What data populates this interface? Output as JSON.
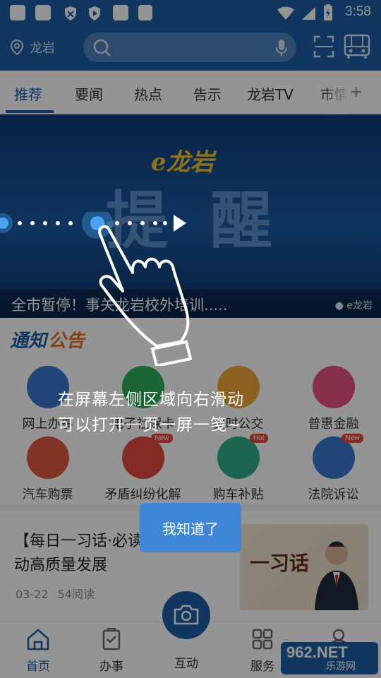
{
  "status_bar": {
    "time": "3:58"
  },
  "header": {
    "location": "龙岩",
    "icons": [
      "location-pin-icon",
      "search-icon",
      "microphone-icon",
      "scan-icon",
      "bus-icon"
    ]
  },
  "tabs": [
    {
      "label": "推荐",
      "active": true
    },
    {
      "label": "要闻"
    },
    {
      "label": "热点"
    },
    {
      "label": "告示"
    },
    {
      "label": "龙岩TV"
    },
    {
      "label": "市情"
    }
  ],
  "banner": {
    "brand": "e龙岩",
    "headline": "提醒",
    "caption": "全市暂停！事关龙岩校外培训.....",
    "source": "e龙岩"
  },
  "notice": {
    "part1": "通知",
    "part2": "公告"
  },
  "services": [
    {
      "label": "网上办事",
      "color": "#3b78cf",
      "badge": ""
    },
    {
      "label": "电子社保卡",
      "color": "#2fae5a",
      "badge": ""
    },
    {
      "label": "实时公交",
      "color": "#f0a53a",
      "badge": ""
    },
    {
      "label": "普惠金融",
      "color": "#e5527c",
      "badge": ""
    },
    {
      "label": "汽车购票",
      "color": "#e05a3f",
      "badge": ""
    },
    {
      "label": "矛盾纠纷化解",
      "color": "#e2493f",
      "badge": "New"
    },
    {
      "label": "购车补贴",
      "color": "#2fae8a",
      "badge": "Hot"
    },
    {
      "label": "法院诉讼",
      "color": "#3b78cf",
      "badge": "New"
    }
  ],
  "news": {
    "title": "【每日一习话·必读】坚定不移推动高质量发展",
    "date": "03-22",
    "reads": "54阅读",
    "thumb_text": "一习话"
  },
  "bottom_nav": [
    {
      "label": "首页",
      "active": true
    },
    {
      "label": "办事"
    },
    {
      "label": "互动"
    },
    {
      "label": "服务"
    },
    {
      "label": "我的"
    }
  ],
  "watermark": {
    "top": "962.NET",
    "bottom": "乐游网"
  },
  "overlay": {
    "hint_line1": "在屏幕左侧区域向右滑动",
    "hint_line2": "可以打开一页一屏一笺~",
    "ok_label": "我知道了"
  },
  "colors": {
    "primary": "#1e5fa8",
    "accent": "#3f86d6",
    "notice_orange": "#e1742e"
  }
}
